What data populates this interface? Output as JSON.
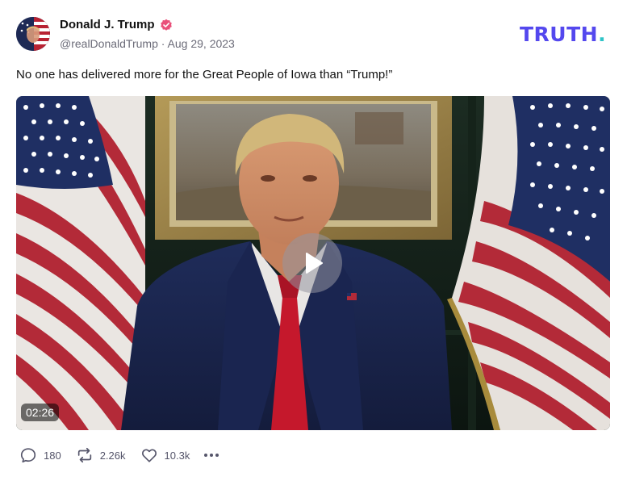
{
  "post": {
    "author": {
      "name": "Donald J. Trump",
      "handle": "@realDonaldTrump",
      "separator": "·",
      "date": "Aug 29, 2023"
    },
    "brand": {
      "text": "TRUTH",
      "dot": "."
    },
    "text": "No one has delivered more for the Great People of Iowa than “Trump!”",
    "video": {
      "duration": "02:26"
    },
    "actions": {
      "replies": "180",
      "retruths": "2.26k",
      "likes": "10.3k"
    }
  },
  "colors": {
    "brand": "#5448ee",
    "brand_dot": "#2ec4c7",
    "verified": "#e9507a",
    "muted_text": "#6b6b78"
  },
  "icons": [
    "verified-badge-icon",
    "play-icon",
    "reply-icon",
    "retruth-icon",
    "heart-icon",
    "more-icon"
  ]
}
